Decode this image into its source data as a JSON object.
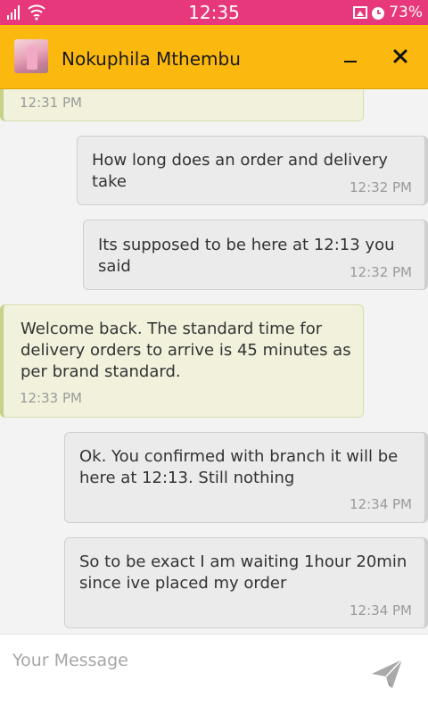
{
  "status_bar": {
    "time": "12:35",
    "battery": "73%"
  },
  "header": {
    "contact_name": "Nokuphila Mthembu"
  },
  "messages": [
    {
      "direction": "in",
      "text": "",
      "time": "12:31 PM"
    },
    {
      "direction": "out",
      "text": "How long does an order and delivery take",
      "time": "12:32 PM"
    },
    {
      "direction": "out",
      "text": "Its supposed to be here at 12:13 you said",
      "time": "12:32 PM"
    },
    {
      "direction": "in",
      "text": "Welcome back. The standard time for\ndelivery orders to arrive is 45 minutes as\nper brand standard.",
      "time": "12:33 PM"
    },
    {
      "direction": "out",
      "text": "Ok. You confirmed with branch it will be\nhere at 12:13. Still nothing",
      "time": "12:34 PM"
    },
    {
      "direction": "out",
      "text": "So to be exact I am waiting 1hour 20min\nsince ive placed my order",
      "time": "12:34 PM"
    }
  ],
  "composer": {
    "placeholder": "Your Message"
  },
  "colors": {
    "status_bar": "#e6387a",
    "header": "#fbb80f",
    "incoming_bubble": "#f1f1dc",
    "outgoing_bubble": "#ebebeb"
  }
}
